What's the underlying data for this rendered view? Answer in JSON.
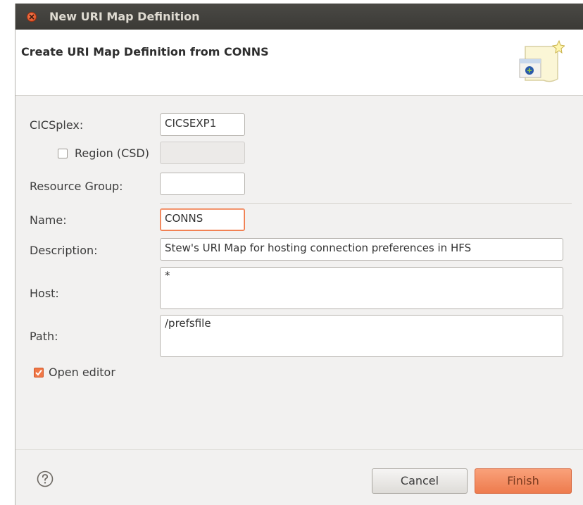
{
  "window": {
    "title": "New URI Map Definition"
  },
  "header": {
    "title": "Create URI Map Definition from CONNS"
  },
  "form": {
    "cicsplex_label": "CICSplex:",
    "cicsplex_value": "CICSEXP1",
    "region_label": "Region (CSD)",
    "region_checked": false,
    "region_value": "",
    "resource_group_label": "Resource Group:",
    "resource_group_value": "",
    "name_label": "Name:",
    "name_value": "CONNS",
    "description_label": "Description:",
    "description_value": "Stew's URI Map for hosting connection preferences in HFS",
    "host_label": "Host:",
    "host_value": "*",
    "path_label": "Path:",
    "path_value": "/prefsfile",
    "open_editor_label": "Open editor",
    "open_editor_checked": true
  },
  "buttons": {
    "cancel": "Cancel",
    "finish": "Finish"
  },
  "icons": {
    "close": "close-icon",
    "help": "help-icon",
    "wizard": "wizard-banner-icon"
  },
  "colors": {
    "accent": "#f07746",
    "titlebar": "#3c3b37"
  }
}
